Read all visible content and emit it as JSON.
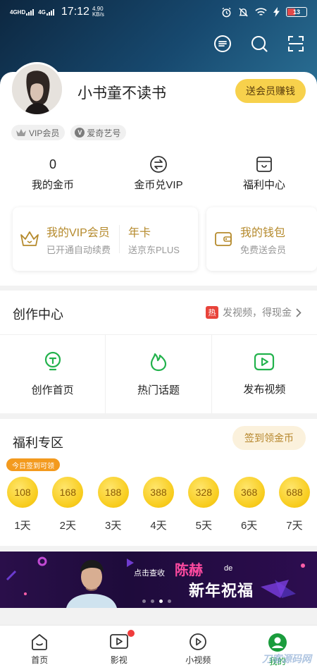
{
  "status_bar": {
    "network_1": "4GHD",
    "network_2": "4G",
    "time": "17:12",
    "speed_value": "4.90",
    "speed_unit": "KB/s",
    "battery": "13"
  },
  "header": {
    "icons": [
      "message-icon",
      "search-icon",
      "scan-icon"
    ]
  },
  "profile": {
    "username": "小书童不读书",
    "member_button": "送会员赚钱",
    "badges": [
      {
        "label": "VIP会员"
      },
      {
        "label": "爱奇艺号"
      }
    ]
  },
  "stats": [
    {
      "value": "0",
      "label": "我的金币"
    },
    {
      "label": "金币兑VIP"
    },
    {
      "label": "福利中心"
    }
  ],
  "vip_card": {
    "title": "我的VIP会员",
    "subtitle": "已开通自动续费",
    "promo_title": "年卡",
    "promo_subtitle": "送京东PLUS"
  },
  "wallet_card": {
    "title": "我的钱包",
    "subtitle": "免费送会员"
  },
  "creation": {
    "title": "创作中心",
    "hot_tag": "热",
    "tip": "发视频，得现金",
    "items": [
      {
        "label": "创作首页"
      },
      {
        "label": "热门话题"
      },
      {
        "label": "发布视频"
      }
    ]
  },
  "welfare": {
    "title": "福利专区",
    "sign_button": "签到领金币",
    "today_tip": "今日签到可领",
    "days": [
      {
        "coins": "108",
        "day": "1天"
      },
      {
        "coins": "168",
        "day": "2天"
      },
      {
        "coins": "188",
        "day": "3天"
      },
      {
        "coins": "388",
        "day": "4天"
      },
      {
        "coins": "328",
        "day": "5天"
      },
      {
        "coins": "368",
        "day": "6天"
      },
      {
        "coins": "688",
        "day": "7天"
      }
    ]
  },
  "banner": {
    "small_text": "点击查收",
    "name": "陈赫",
    "de": "de",
    "main_text": "新年祝福",
    "active_dot": 2
  },
  "bottom_nav": [
    {
      "label": "首页"
    },
    {
      "label": "影视"
    },
    {
      "label": "小视频"
    },
    {
      "label": "我的"
    }
  ],
  "watermark": "刀客源码网",
  "colors": {
    "accent_gold": "#f7d14c",
    "vip_text": "#b58a2c",
    "green": "#1a9c3c",
    "hot_red": "#e8433a"
  }
}
